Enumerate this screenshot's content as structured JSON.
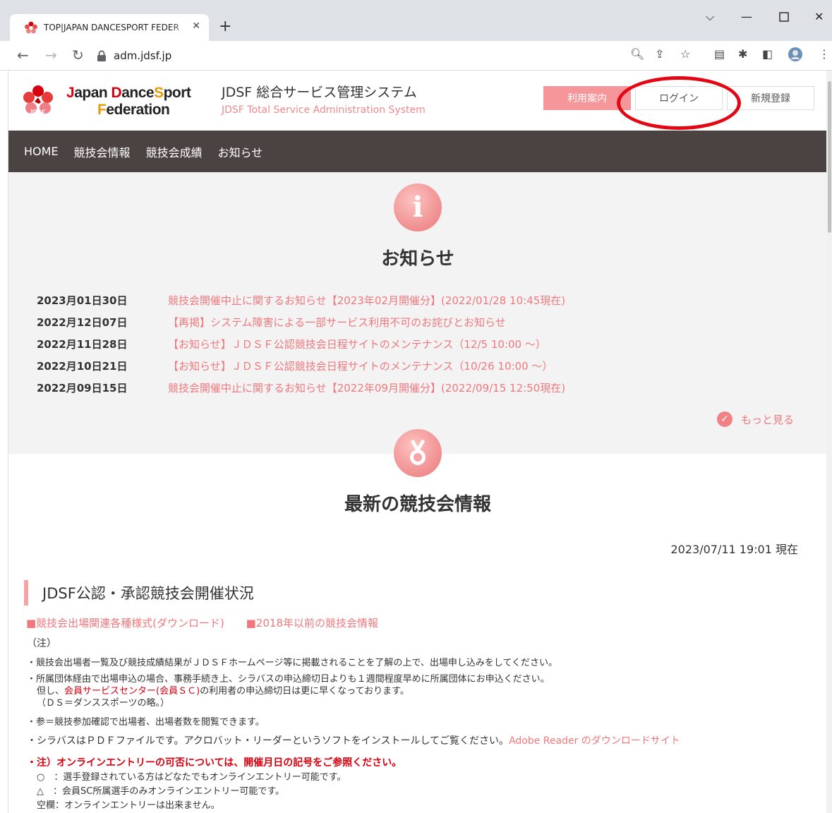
{
  "browser": {
    "tab_title": "TOP|JAPAN DANCESPORT FEDER",
    "url": "adm.jdsf.jp",
    "new_tab_glyph": "+",
    "tab_close_glyph": "✕"
  },
  "header": {
    "logo_line1_j": "J",
    "logo_line1_apan": "apan ",
    "logo_line1_d": "D",
    "logo_line1_ance": "ance",
    "logo_line1_s": "S",
    "logo_line1_port": "port",
    "logo_line2_f": "F",
    "logo_line2_rest": "ederation",
    "logo_badge": "JDSF",
    "system_title": "JDSF 総合サービス管理システム",
    "system_subtitle": "JDSF Total Service Administration System",
    "guide_button": "利用案内",
    "login_button": "ログイン",
    "register_button": "新規登録"
  },
  "nav": {
    "items": [
      "HOME",
      "競技会情報",
      "競技会成績",
      "お知らせ"
    ]
  },
  "news": {
    "heading": "お知らせ",
    "icon_glyph": "i",
    "items": [
      {
        "date": "2023月01日30日",
        "title": "競技会開催中止に関するお知らせ【2023年02月開催分】(2022/01/28 10:45現在)"
      },
      {
        "date": "2022月12日07日",
        "title": "【再掲】システム障害による一部サービス利用不可のお詫びとお知らせ"
      },
      {
        "date": "2022月11日28日",
        "title": "【お知らせ】ＪＤＳＦ公認競技会日程サイトのメンテナンス（12/5 10:00 ～）"
      },
      {
        "date": "2022月10日21日",
        "title": "【お知らせ】ＪＤＳＦ公認競技会日程サイトのメンテナンス（10/26 10:00 ～）"
      },
      {
        "date": "2022月09日15日",
        "title": "競技会開催中止に関するお知らせ【2022年09月開催分】(2022/09/15 12:50現在)"
      }
    ],
    "more_label": "もっと見る"
  },
  "competitions": {
    "heading": "最新の競技会情報",
    "timestamp": "2023/07/11 19:01 現在",
    "section_title": "JDSF公認・承認競技会開催状況",
    "link_forms": "■競技会出場関連各種様式(ダウンロード)",
    "link_archive": "■2018年以前の競技会情報",
    "note_label": "（注）",
    "note1": "・競技会出場者一覧及び競技成績結果がＪＤＳＦホームページ等に掲載されることを了解の上で、出場申し込みをしてください。",
    "note2": "・所属団体経由で出場申込の場合、事務手続き上、シラバスの申込締切日よりも１週間程度早めに所属団体にお申込ください。",
    "note3_pre": "但し、",
    "note3_link": "会員サービスセンター(会員ＳＣ)",
    "note3_post": "の利用者の申込締切日は更に早くなっております。",
    "note4": "（ＤＳ＝ダンススポーツの略。）",
    "note5": "・参＝競技参加確認で出場者、出場者数を閲覧できます。",
    "note6_pre": "・シラバスはＰＤＦファイルです。アクロバット・リーダーというソフトをインストールしてご覧ください。",
    "note6_link": "Adobe Reader のダウンロードサイト",
    "warn": "・注）オンラインエントリーの可否については、開催月日の記号をご参照ください。",
    "legend1": "○　：選手登録されている方はどなたでもオンラインエントリー可能です。",
    "legend2": "△　：会員SC所属選手のみオンラインエントリー可能です。",
    "legend3": "空欄：オンラインエントリーは出来ません。"
  },
  "colors": {
    "accent_pink": "#f0787d",
    "nav_bg": "#4b4242",
    "guide_button_bg": "#f5969b",
    "annotation_red": "#e30613"
  }
}
